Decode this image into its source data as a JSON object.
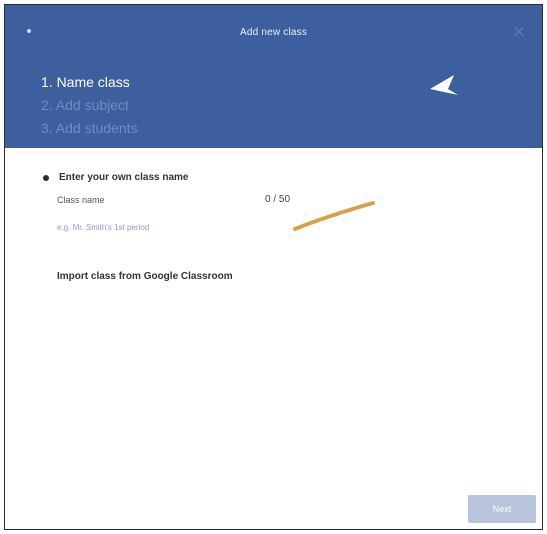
{
  "dialog": {
    "title": "Add new class",
    "close_icon": "close-icon",
    "steps": [
      {
        "label": "1. Name class",
        "active": true
      },
      {
        "label": "2. Add subject",
        "active": false
      },
      {
        "label": "3. Add students",
        "active": false
      }
    ]
  },
  "form": {
    "own_name_option": "Enter your own class name",
    "class_name_label": "Class name",
    "char_count": "0 / 50",
    "class_name_value": "",
    "class_name_placeholder": "e.g. Mr. Smith's 1st period",
    "import_option": "Import class from Google Classroom"
  },
  "footer": {
    "next_label": "Next"
  },
  "colors": {
    "header_bg": "#3d5f9e",
    "active_step": "#ffffff",
    "inactive_step": "#6f8dc4",
    "annotation_stroke": "#d9a24a",
    "next_disabled_bg": "#b7c4dc"
  }
}
